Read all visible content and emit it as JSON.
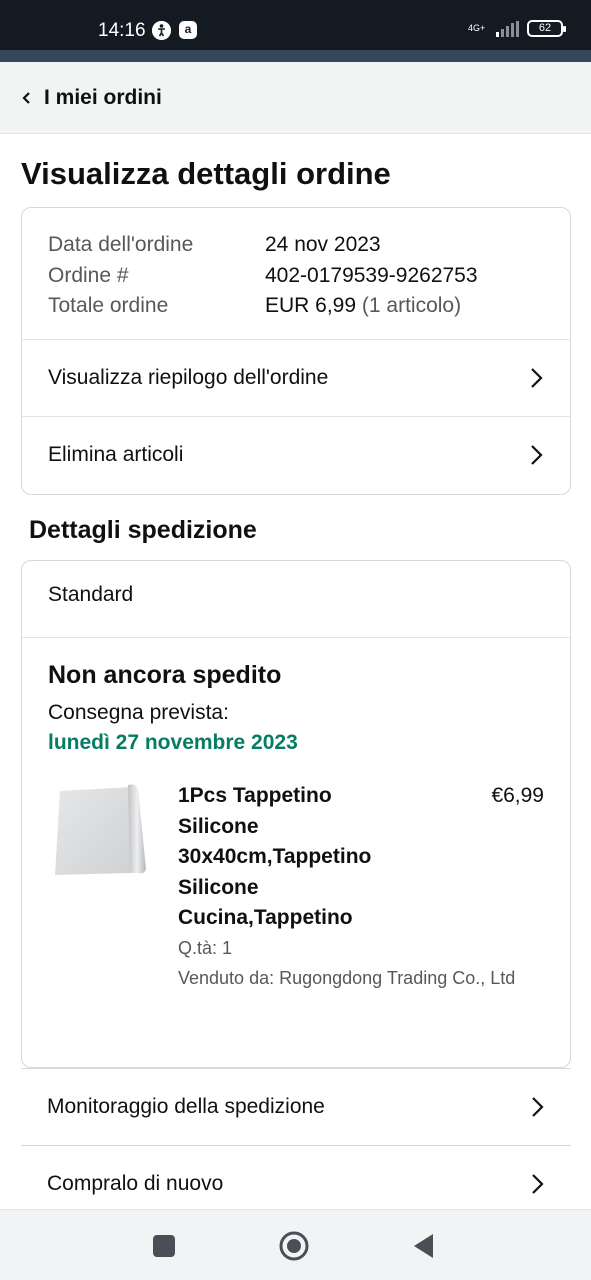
{
  "status_bar": {
    "time": "14:16",
    "icon_a": "a",
    "network": "4G+",
    "battery": "62"
  },
  "header": {
    "back_label": "I miei ordini"
  },
  "page": {
    "title": "Visualizza dettagli ordine"
  },
  "order_summary": {
    "date_label": "Data dell'ordine",
    "date_value": "24 nov 2023",
    "order_label": "Ordine #",
    "order_value": "402-0179539-9262753",
    "total_label": "Totale ordine",
    "total_value": "EUR 6,99",
    "total_items": "(1 articolo)",
    "links": [
      "Visualizza riepilogo dell'ordine",
      "Elimina articoli"
    ]
  },
  "shipping": {
    "section_title": "Dettagli spedizione",
    "method": "Standard",
    "status": "Non ancora spedito",
    "expected_label": "Consegna prevista:",
    "expected_date": "lunedì 27 novembre 2023",
    "date_color": "#067d62",
    "item": {
      "title": "1Pcs Tappetino Silicone 30x40cm,Tappetino Silicone Cucina,Tappetino",
      "price": "€6,99",
      "qty": "Q.tà: 1",
      "seller": "Venduto da: Rugongdong Trading Co., Ltd"
    }
  },
  "actions": [
    "Monitoraggio della spedizione",
    "Compralo di nuovo"
  ],
  "icons": {
    "back": "chevron-left-icon",
    "row": "chevron-right-icon"
  }
}
